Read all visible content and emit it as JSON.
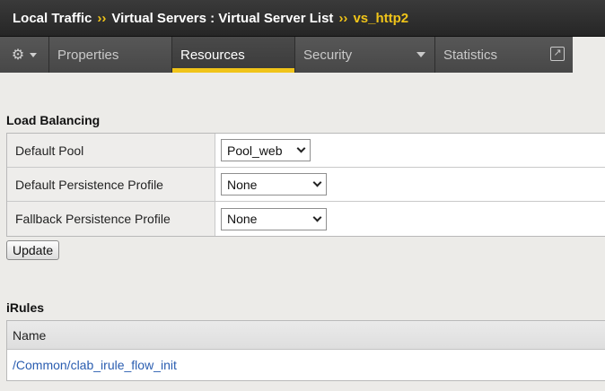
{
  "breadcrumb": {
    "items": [
      "Local Traffic",
      "Virtual Servers : Virtual Server List"
    ],
    "separator": "››",
    "current": "vs_http2"
  },
  "tabs": {
    "gear_icon": "gear-icon",
    "properties": "Properties",
    "resources": "Resources",
    "security": "Security",
    "statistics": "Statistics",
    "active": "Resources",
    "accent_color": "#f0c419"
  },
  "load_balancing": {
    "title": "Load Balancing",
    "rows": [
      {
        "label": "Default Pool",
        "value": "Pool_web"
      },
      {
        "label": "Default Persistence Profile",
        "value": "None"
      },
      {
        "label": "Fallback Persistence Profile",
        "value": "None"
      }
    ],
    "update_label": "Update"
  },
  "irules": {
    "title": "iRules",
    "column_header": "Name",
    "rows": [
      "/Common/clab_irule_flow_init"
    ],
    "link_color": "#2a5db0"
  }
}
